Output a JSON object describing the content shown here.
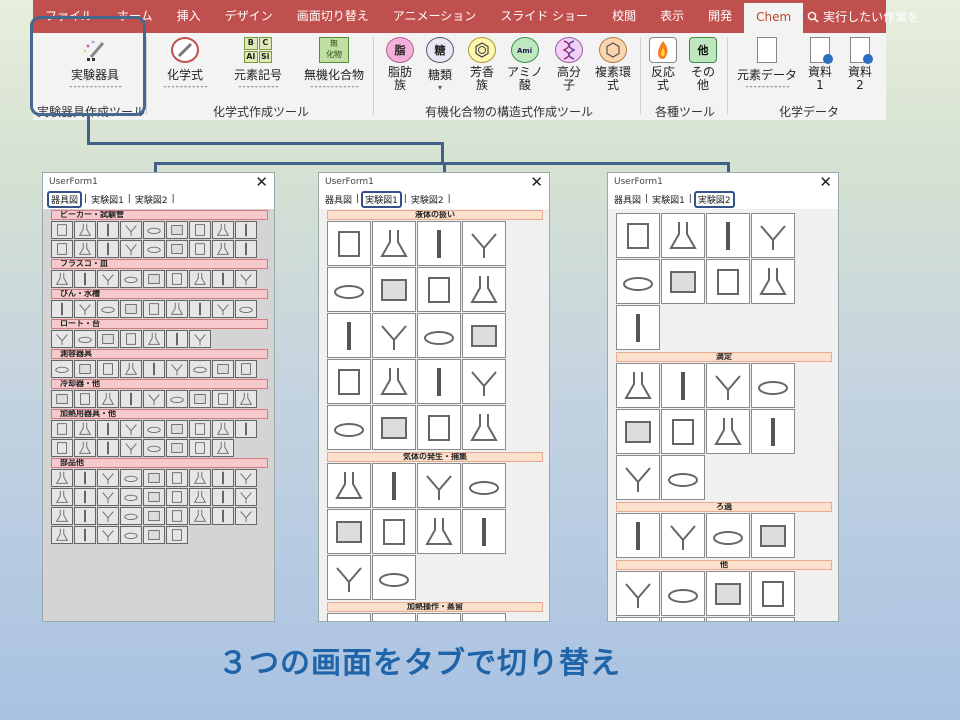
{
  "ribbon": {
    "tabs": [
      "ファイル",
      "ホーム",
      "挿入",
      "デザイン",
      "画面切り替え",
      "アニメーション",
      "スライド ショー",
      "校閲",
      "表示",
      "開発",
      "Chem"
    ],
    "active_tab": "Chem",
    "search_text": "実行したい作業を",
    "buttons": {
      "lab_tools": "実験器具",
      "formula": "化学式",
      "element_symbol": "元素記号",
      "inorganic": "無機化合物",
      "fat": "脂肪\n族",
      "sugar": "糖類",
      "aromatic": "芳香\n族",
      "amino": "アミノ\n酸",
      "polymer": "高分\n子",
      "heterocycle": "複素環\n式",
      "reaction": "反応\n式",
      "other": "その\n他",
      "element_data": "元素データ",
      "material1": "資料\n1",
      "material2": "資料\n2"
    },
    "icons": {
      "fat": "脂",
      "sugar": "糖",
      "aromatic": "",
      "amino": "",
      "polymer": "",
      "heterocycle": "",
      "other": "他",
      "element_grid": [
        "B",
        "C",
        "Al",
        "Si"
      ],
      "inorganic": "無\n化物"
    },
    "group_labels": {
      "lab_tools_group": "実験器具作成ツール",
      "formula_group": "化学式作成ツール",
      "organic_group": "有機化合物の構造式作成ツール",
      "misc_group": "各種ツール",
      "data_group": "化学データ"
    },
    "colors": {
      "tab_bar": "#c0504d",
      "highlight": "#44688e"
    }
  },
  "forms": [
    {
      "title": "UserForm1",
      "tabs": [
        "器具図",
        "実験図1",
        "実験図2"
      ],
      "highlighted_tab": 0,
      "categories": [
        "ビーカー・試験管",
        "フラスコ・皿",
        "びん・水槽",
        "ロート・台",
        "測容器具",
        "冷却器・他",
        "加熱用器具・他",
        "部品他"
      ],
      "rows_per_category": [
        [
          9,
          9
        ],
        [
          9
        ],
        [
          9
        ],
        [
          7
        ],
        [
          9
        ],
        [
          9
        ],
        [
          9,
          8
        ],
        [
          9,
          9,
          9,
          6
        ]
      ]
    },
    {
      "title": "UserForm1",
      "tabs": [
        "器具図",
        "実験図1",
        "実験図2"
      ],
      "highlighted_tab": 1,
      "categories": [
        "液体の扱い",
        "気体の発生・捕集",
        "加熱操作・蒸留"
      ],
      "cells_per_category": [
        20,
        10,
        10
      ]
    },
    {
      "title": "UserForm1",
      "tabs": [
        "器具図",
        "実験図1",
        "実験図2"
      ],
      "highlighted_tab": 2,
      "categories": [
        "",
        "滴定",
        "ろ過",
        "他"
      ],
      "cells_per_category": [
        9,
        10,
        4,
        10
      ]
    }
  ],
  "caption": "３つの画面をタブで切り替え"
}
